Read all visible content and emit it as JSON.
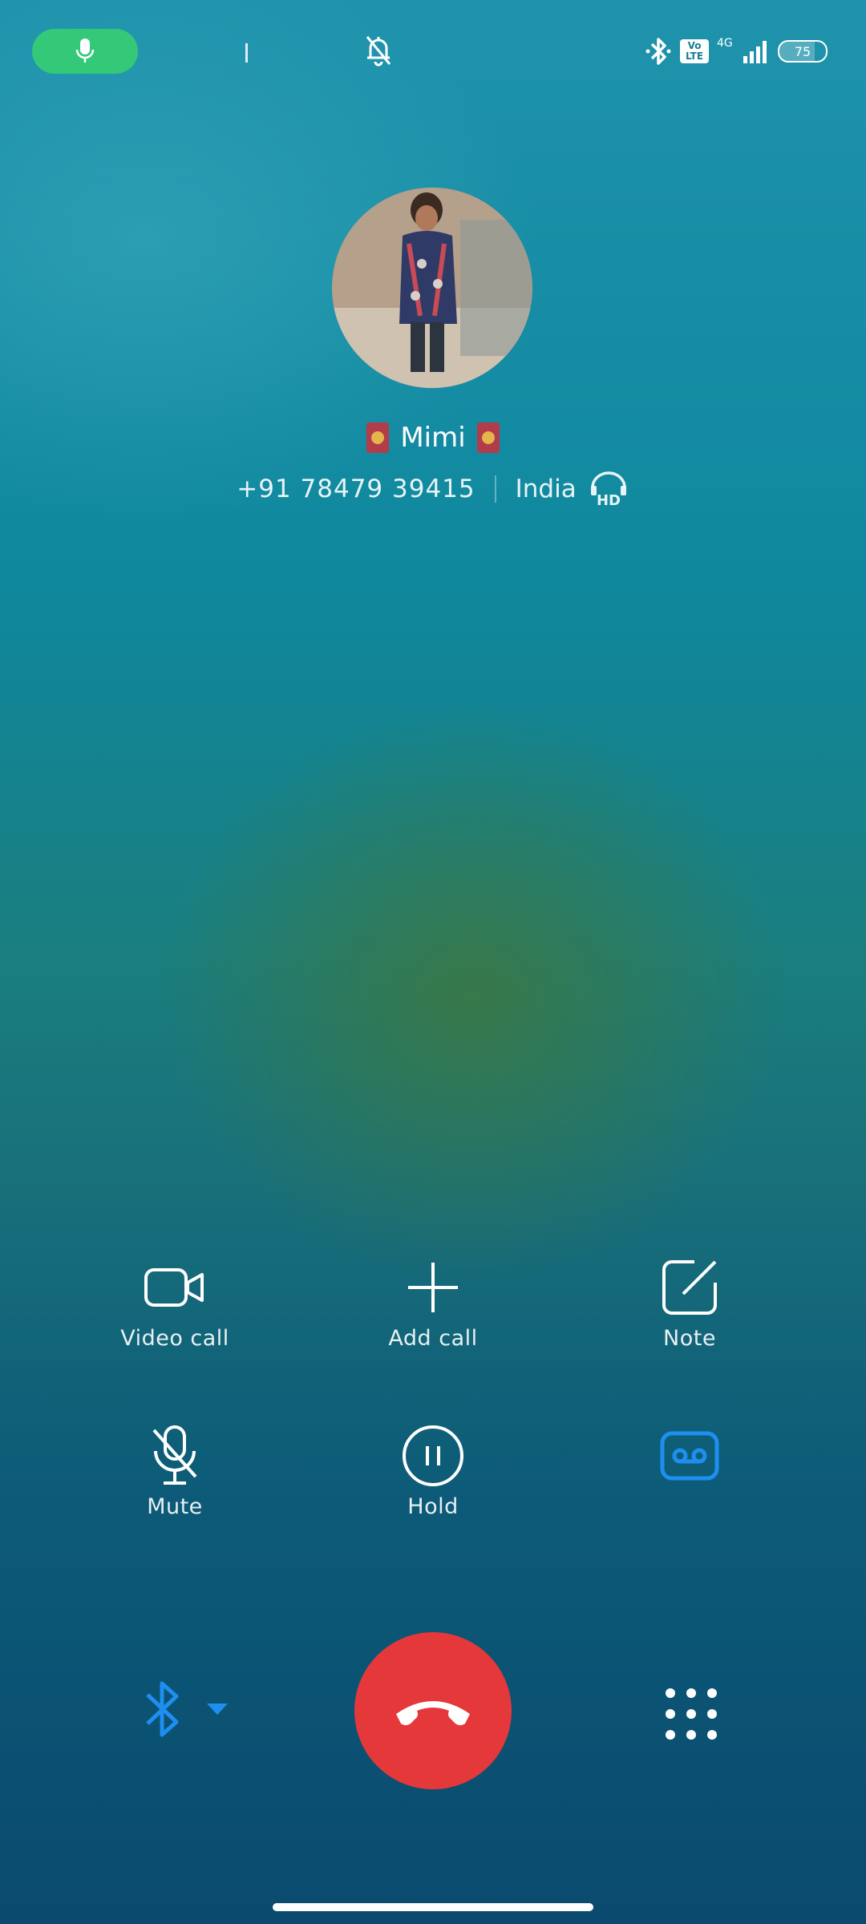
{
  "status_bar": {
    "icons": [
      "mic-icon",
      "bell-off-icon",
      "bluetooth-icon",
      "volte-icon",
      "signal-4g-icon",
      "battery-icon"
    ],
    "volte_top": "Vo",
    "volte_bottom": "LTE",
    "network": "4G",
    "battery": "75",
    "battery_level": 0.75,
    "active_call_color": "#34c879"
  },
  "contact": {
    "name": "Mimi",
    "number": "+91  78479  39415",
    "location": "India",
    "hd_label": "HD"
  },
  "actions": [
    {
      "label": "Video call",
      "icon": "video-call-icon"
    },
    {
      "label": "Add call",
      "icon": "add-call-icon"
    },
    {
      "label": "Note",
      "icon": "note-icon"
    },
    {
      "label": "Mute",
      "icon": "mute-icon"
    },
    {
      "label": "Hold",
      "icon": "hold-icon"
    },
    {
      "label": "",
      "icon": "record-icon",
      "active_color": "#1e8ff0"
    }
  ],
  "bottom": {
    "audio_route_icon": "bluetooth-icon",
    "end_call_color": "#e5383b",
    "end_call_icon": "end-call-icon",
    "dialpad_icon": "dialpad-icon"
  }
}
